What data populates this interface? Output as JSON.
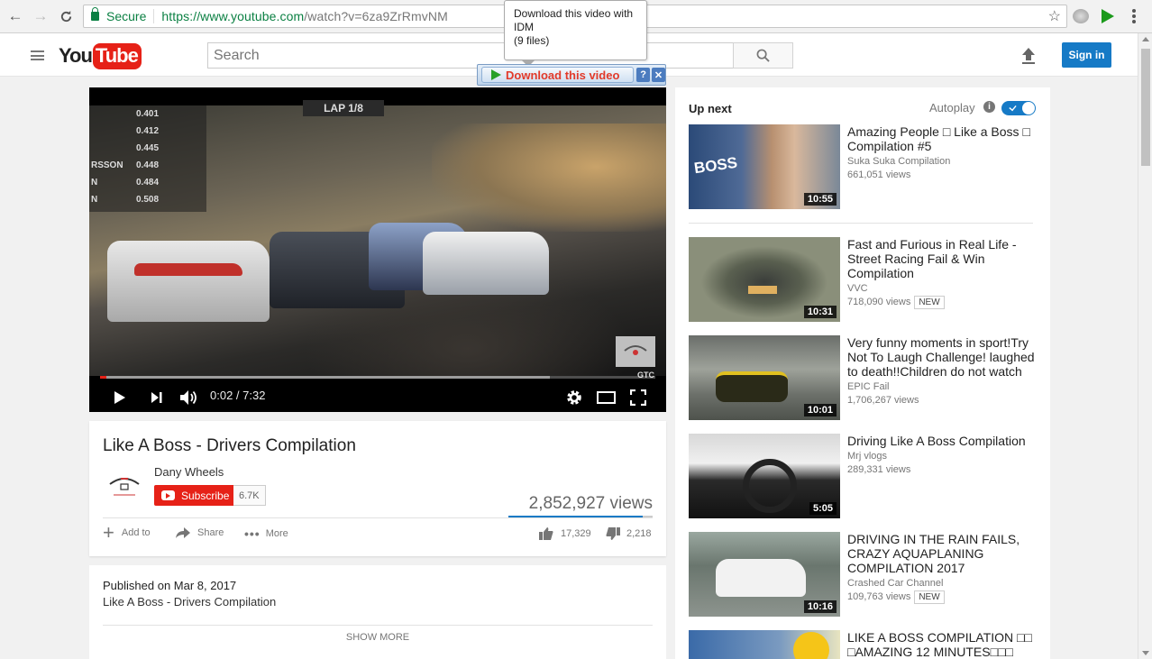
{
  "browser": {
    "secure_label": "Secure",
    "url_host": "https://www.youtube.com",
    "url_path": "/watch?v=6za9ZrRmvNM"
  },
  "header": {
    "logo_you": "You",
    "logo_tube": "Tube",
    "search_placeholder": "Search",
    "signin_label": "Sign in"
  },
  "idm": {
    "tooltip_line1": "Download this video with",
    "tooltip_line2": "IDM",
    "tooltip_line3": "(9  files)",
    "download_label": "Download this video",
    "help": "?",
    "close": "✕"
  },
  "player": {
    "lap": "LAP  1/8",
    "leaderboard": [
      {
        "name": "",
        "time": "0.401"
      },
      {
        "name": "",
        "time": "0.412"
      },
      {
        "name": "",
        "time": "0.445"
      },
      {
        "name": "RSSON",
        "time": "0.448"
      },
      {
        "name": "N",
        "time": "0.484"
      },
      {
        "name": "N",
        "time": "0.508"
      }
    ],
    "time": "0:02 / 7:32",
    "progress": 0.004,
    "buffered": 0.81,
    "watermark_text": "GTC"
  },
  "video": {
    "title": "Like A Boss - Drivers Compilation",
    "channel": "Dany Wheels",
    "subscribe_label": "Subscribe",
    "subscriber_count": "6.7K",
    "views": "2,852,927 views",
    "like_ratio": 0.93,
    "actions": {
      "add_to": "Add to",
      "share": "Share",
      "more": "More"
    },
    "likes": "17,329",
    "dislikes": "2,218"
  },
  "description": {
    "published": "Published on Mar 8, 2017",
    "text": "Like A Boss - Drivers Compilation",
    "show_more": "SHOW MORE"
  },
  "sidebar": {
    "up_next": "Up next",
    "autoplay": "Autoplay",
    "autoplay_on": true,
    "items": [
      {
        "title": "Amazing People □ Like a Boss □ Compilation #5",
        "channel": "Suka Suka Compilation",
        "views": "661,051 views",
        "badge": "",
        "duration": "10:55",
        "thumb_text": "BOSS"
      },
      {
        "title": "Fast and Furious in Real Life - Street Racing Fail & Win Compilation",
        "channel": "VVC",
        "views": "718,090 views",
        "badge": "NEW",
        "duration": "10:31"
      },
      {
        "title": "Very funny moments in sport!Try Not To Laugh Challenge! laughed to death!!Children do not watch",
        "channel": "EPIC Fail",
        "views": "1,706,267 views",
        "badge": "",
        "duration": "10:01"
      },
      {
        "title": "Driving Like A Boss Compilation",
        "channel": "Mrj vlogs",
        "views": "289,331 views",
        "badge": "",
        "duration": "5:05"
      },
      {
        "title": "DRIVING IN THE RAIN FAILS, CRAZY AQUAPLANING COMPILATION 2017",
        "channel": "Crashed Car Channel",
        "views": "109,763 views",
        "badge": "NEW",
        "duration": "10:16"
      },
      {
        "title": "LIKE A BOSS COMPILATION □□ □AMAZING 12 MINUTES□□□",
        "channel": "",
        "views": "",
        "badge": "",
        "duration": ""
      }
    ]
  },
  "colors": {
    "brand_red": "#e62117",
    "accent_blue": "#167ac6",
    "secure_green": "#0b8043"
  }
}
